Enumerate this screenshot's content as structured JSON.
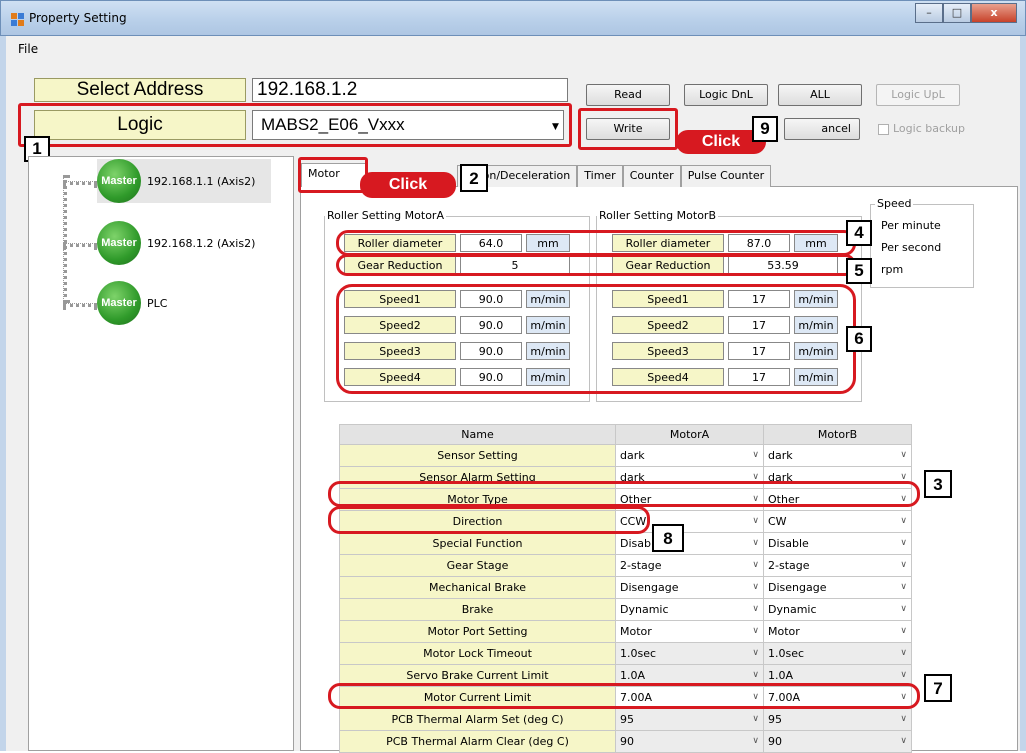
{
  "window": {
    "title": "Property Setting",
    "minimize": "–",
    "maximize": "□",
    "close": "x"
  },
  "menu": {
    "file": "File"
  },
  "address": {
    "label": "Select Address",
    "value": "192.168.1.2"
  },
  "logic": {
    "label": "Logic",
    "value": "MABS2_E06_Vxxx"
  },
  "buttons": {
    "read": "Read",
    "logic_dnl": "Logic DnL",
    "all": "ALL",
    "logic_upl": "Logic UpL",
    "write": "Write",
    "cancel": "ancel",
    "logic_backup": "Logic backup"
  },
  "callouts": {
    "n1": "1",
    "n2": "2",
    "n3": "3",
    "n4": "4",
    "n5": "5",
    "n6": "6",
    "n7": "7",
    "n8": "8",
    "n9": "9",
    "click": "Click"
  },
  "tree": [
    {
      "badge": "Master",
      "label": "192.168.1.1 (Axis2)"
    },
    {
      "badge": "Master",
      "label": "192.168.1.2 (Axis2)"
    },
    {
      "badge": "Master",
      "label": "PLC"
    }
  ],
  "tabs": [
    "Motor",
    "ration/Deceleration",
    "Timer",
    "Counter",
    "Pulse Counter"
  ],
  "speed_group": {
    "title": "Speed",
    "options": [
      "Per minute",
      "Per second",
      "rpm"
    ]
  },
  "motorA": {
    "title": "Roller Setting MotorA",
    "roller_label": "Roller diameter",
    "roller_value": "64.0",
    "roller_unit": "mm",
    "gear_label": "Gear Reduction",
    "gear_value": "5",
    "speeds": [
      {
        "label": "Speed1",
        "value": "90.0",
        "unit": "m/min"
      },
      {
        "label": "Speed2",
        "value": "90.0",
        "unit": "m/min"
      },
      {
        "label": "Speed3",
        "value": "90.0",
        "unit": "m/min"
      },
      {
        "label": "Speed4",
        "value": "90.0",
        "unit": "m/min"
      }
    ]
  },
  "motorB": {
    "title": "Roller Setting MotorB",
    "roller_label": "Roller diameter",
    "roller_value": "87.0",
    "roller_unit": "mm",
    "gear_label": "Gear Reduction",
    "gear_value": "53.59",
    "speeds": [
      {
        "label": "Speed1",
        "value": "17",
        "unit": "m/min"
      },
      {
        "label": "Speed2",
        "value": "17",
        "unit": "m/min"
      },
      {
        "label": "Speed3",
        "value": "17",
        "unit": "m/min"
      },
      {
        "label": "Speed4",
        "value": "17",
        "unit": "m/min"
      }
    ]
  },
  "grid": {
    "headers": [
      "Name",
      "MotorA",
      "MotorB"
    ],
    "rows": [
      {
        "name": "Sensor Setting",
        "a": "dark",
        "b": "dark"
      },
      {
        "name": "Sensor Alarm Setting",
        "a": "dark",
        "b": "dark"
      },
      {
        "name": "Motor Type",
        "a": "Other",
        "b": "Other"
      },
      {
        "name": "Direction",
        "a": "CCW",
        "b": "CW"
      },
      {
        "name": "Special Function",
        "a": "Disab",
        "b": "Disable"
      },
      {
        "name": "Gear Stage",
        "a": "2-stage",
        "b": "2-stage"
      },
      {
        "name": "Mechanical Brake",
        "a": "Disengage",
        "b": "Disengage"
      },
      {
        "name": "Brake",
        "a": "Dynamic",
        "b": "Dynamic"
      },
      {
        "name": "Motor Port Setting",
        "a": "Motor",
        "b": "Motor"
      },
      {
        "name": "Motor Lock Timeout",
        "a": "1.0sec",
        "b": "1.0sec"
      },
      {
        "name": "Servo Brake Current Limit",
        "a": "1.0A",
        "b": "1.0A"
      },
      {
        "name": "Motor Current Limit",
        "a": "7.00A",
        "b": "7.00A"
      },
      {
        "name": "PCB Thermal Alarm Set (deg C)",
        "a": "95",
        "b": "95"
      },
      {
        "name": "PCB Thermal Alarm Clear (deg C)",
        "a": "90",
        "b": "90"
      }
    ]
  },
  "colors": {
    "accent_red": "#d71920",
    "label_yellow": "#f6f6c8",
    "master_green": "#2f9a2a"
  }
}
